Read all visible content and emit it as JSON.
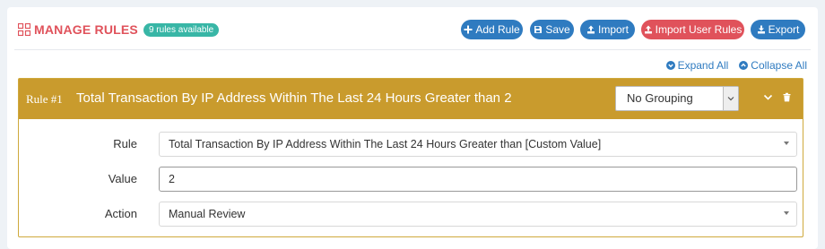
{
  "header": {
    "title": "MANAGE RULES",
    "badge": "9 rules available",
    "buttons": {
      "add_rule": "Add Rule",
      "save": "Save",
      "import": "Import",
      "import_user_rules": "Import User Rules",
      "export": "Export"
    }
  },
  "toggles": {
    "expand_all": "Expand All",
    "collapse_all": "Collapse All"
  },
  "rule": {
    "number": "Rule #1",
    "title": "Total Transaction By IP Address Within The Last 24 Hours Greater than 2",
    "grouping": "No Grouping",
    "fields": {
      "rule_label": "Rule",
      "rule_value": "Total Transaction By IP Address Within The Last 24 Hours Greater than [Custom Value]",
      "value_label": "Value",
      "value_value": "2",
      "action_label": "Action",
      "action_value": "Manual Review"
    }
  },
  "colors": {
    "title_red": "#e0525b",
    "badge_teal": "#38b6a6",
    "button_blue": "#2f7bc0",
    "button_red": "#e0525b",
    "rule_header_gold": "#c99b2d"
  },
  "icons": [
    "grid-icon",
    "plus-icon",
    "save-icon",
    "upload-icon",
    "download-icon",
    "chevron-down-circle-icon",
    "chevron-up-circle-icon",
    "chevron-down-icon",
    "trash-icon"
  ]
}
